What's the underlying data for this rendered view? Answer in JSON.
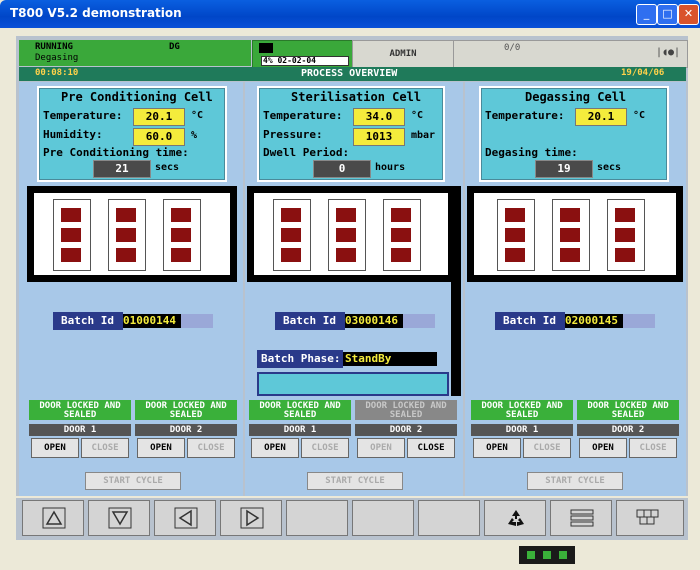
{
  "window": {
    "title": "T800 V5.2 demonstration",
    "minimize": "_",
    "maximize": "□",
    "close": "✕"
  },
  "status": {
    "state": "RUNNING",
    "code": "DG",
    "phase": "Degasing",
    "media_text": "4% 02-02-04",
    "user": "ADMIN",
    "alarm_count": "0/0"
  },
  "header": {
    "time": "00:08:10",
    "title": "PROCESS OVERVIEW",
    "date": "19/04/06"
  },
  "cells": [
    {
      "title": "Pre Conditioning Cell",
      "temperature_label": "Temperature:",
      "temperature": "20.1",
      "temperature_unit": "°C",
      "humidity_label": "Humidity:",
      "humidity": "60.0",
      "humidity_unit": "%",
      "time_label": "Pre Conditioning time:",
      "time": "21",
      "time_unit": "secs",
      "batch_label": "Batch Id",
      "batch_id": "01000144",
      "door1_status": "DOOR LOCKED AND SEALED",
      "door1_label": "DOOR 1",
      "door2_status": "DOOR LOCKED AND SEALED",
      "door2_label": "DOOR 2",
      "open": "OPEN",
      "close": "CLOSE",
      "start": "START CYCLE"
    },
    {
      "title": "Sterilisation Cell",
      "temperature_label": "Temperature:",
      "temperature": "34.0",
      "temperature_unit": "°C",
      "pressure_label": "Pressure:",
      "pressure": "1013",
      "pressure_unit": "mbar",
      "time_label": "Dwell Period:",
      "time": "0",
      "time_unit": "hours",
      "batch_label": "Batch Id",
      "batch_id": "03000146",
      "phase_label": "Batch Phase:",
      "phase": "StandBy",
      "door1_status": "DOOR LOCKED AND SEALED",
      "door1_label": "DOOR 1",
      "door2_status": "DOOR LOCKED AND SEALED",
      "door2_label": "DOOR 2",
      "open": "OPEN",
      "close": "CLOSE",
      "start": "START CYCLE"
    },
    {
      "title": "Degassing Cell",
      "temperature_label": "Temperature:",
      "temperature": "20.1",
      "temperature_unit": "°C",
      "time_label": "Degasing time:",
      "time": "19",
      "time_unit": "secs",
      "batch_label": "Batch Id",
      "batch_id": "02000145",
      "door1_status": "DOOR LOCKED AND SEALED",
      "door1_label": "DOOR 1",
      "door2_status": "DOOR LOCKED AND SEALED",
      "door2_label": "DOOR 2",
      "open": "OPEN",
      "close": "CLOSE",
      "start": "START CYCLE"
    }
  ],
  "nav_icons": [
    "up-arrow-icon",
    "down-arrow-icon",
    "left-arrow-icon",
    "right-arrow-icon",
    "blank",
    "blank",
    "blank",
    "recycle-icon",
    "list-icon",
    "grid-icon"
  ],
  "colors": {
    "panel": "#a8c8e8",
    "info": "#5ec8d8",
    "value": "#f4ec3c",
    "door_ok": "#3ab03a",
    "header": "#1f7a5a"
  }
}
